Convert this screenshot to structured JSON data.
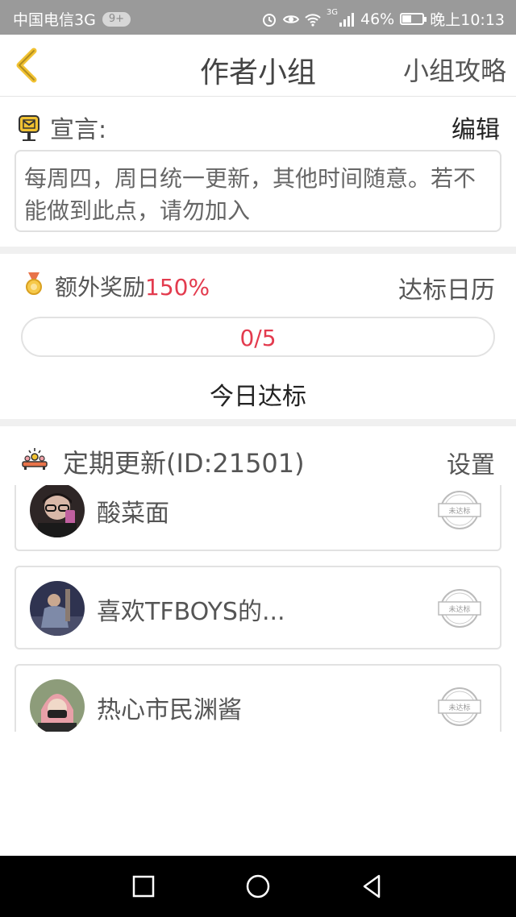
{
  "status_bar": {
    "carrier": "中国电信3G",
    "badge": "9+",
    "net_type": "3G",
    "battery_pct": "46%",
    "battery_level": 0.46,
    "time": "晚上10:13"
  },
  "navbar": {
    "title": "作者小组",
    "right_label": "小组攻略",
    "accent_color": "#f1c232"
  },
  "manifesto": {
    "label": "宣言:",
    "edit_label": "编辑",
    "text": "每周四，周日统一更新，其他时间随意。若不能做到此点，请勿加入"
  },
  "reward": {
    "label": "额外奖励",
    "percent": "150%",
    "calendar_label": "达标日历",
    "progress_text": "0/5",
    "progress_value": 0,
    "today_label": "今日达标",
    "highlight_color": "#e33b4e"
  },
  "group": {
    "title": "定期更新(ID:21501)",
    "settings_label": "设置",
    "stamp_label": "未达标",
    "members": [
      {
        "name": "酸菜面",
        "avatar_bg": "#3b2f2f"
      },
      {
        "name": "喜欢TFBOYS的...",
        "avatar_bg": "#3a3f5a"
      },
      {
        "name": "热心市民渊酱",
        "avatar_bg": "#7a8a6a"
      }
    ]
  },
  "system_nav": {
    "icons": [
      "square-icon",
      "circle-icon",
      "triangle-back-icon"
    ]
  }
}
